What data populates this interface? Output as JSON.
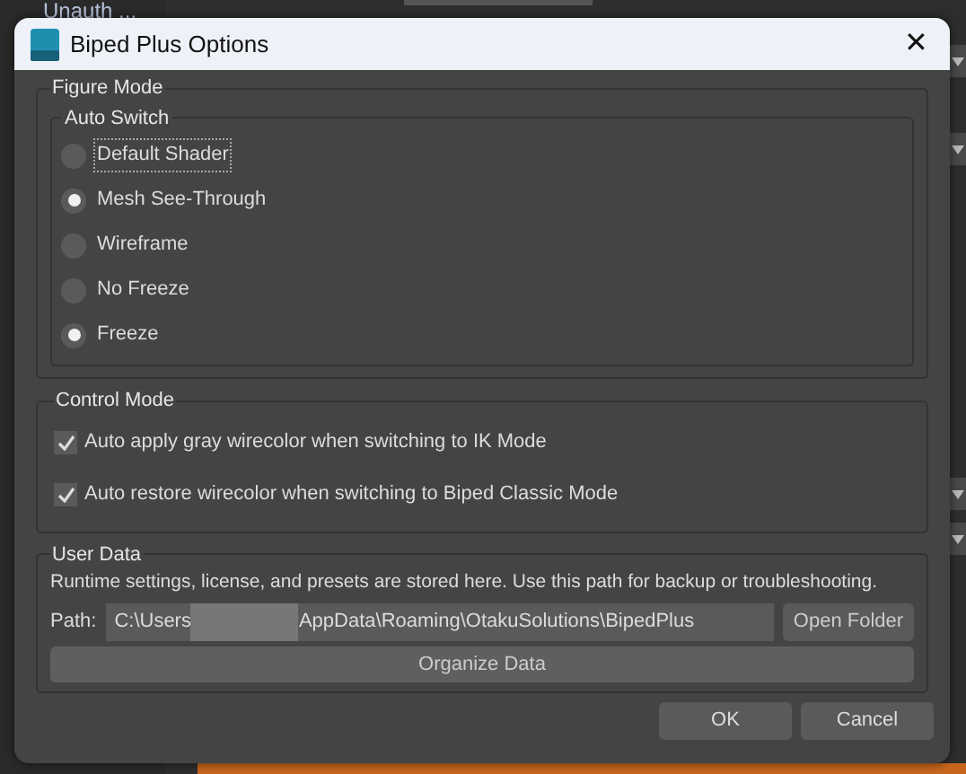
{
  "background": {
    "tree_item": "Unauth ..."
  },
  "window": {
    "title": "Biped Plus Options",
    "close": "✕"
  },
  "figure_mode": {
    "title": "Figure Mode",
    "auto_switch": {
      "title": "Auto Switch",
      "options": [
        {
          "label": "Default Shader",
          "selected": false,
          "focused": true
        },
        {
          "label": "Mesh See-Through",
          "selected": true,
          "focused": false
        },
        {
          "label": "Wireframe",
          "selected": false,
          "focused": false
        },
        {
          "label": "No Freeze",
          "selected": false,
          "focused": false
        },
        {
          "label": "Freeze",
          "selected": true,
          "focused": false
        }
      ]
    }
  },
  "control_mode": {
    "title": "Control Mode",
    "options": [
      {
        "label": "Auto apply gray wirecolor when switching to IK Mode",
        "checked": true
      },
      {
        "label": "Auto restore wirecolor when switching to Biped Classic Mode",
        "checked": true
      }
    ]
  },
  "user_data": {
    "title": "User Data",
    "description": "Runtime settings, license, and presets are stored here. Use this path for backup or troubleshooting.",
    "path_label": "Path:",
    "path_start": "C:\\Users",
    "path_end": "AppData\\Roaming\\OtakuSolutions\\BipedPlus",
    "open_button": "Open Folder",
    "organize_button": "Organize Data"
  },
  "buttons": [
    "OK",
    "Cancel"
  ]
}
